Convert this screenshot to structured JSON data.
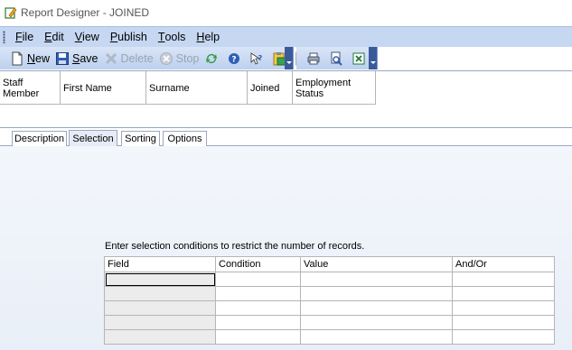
{
  "window": {
    "title": "Report Designer - JOINED"
  },
  "menu": [
    {
      "underline": "F",
      "rest": "ile"
    },
    {
      "underline": "E",
      "rest": "dit"
    },
    {
      "underline": "V",
      "rest": "iew"
    },
    {
      "underline": "P",
      "rest": "ublish"
    },
    {
      "underline": "T",
      "rest": "ools"
    },
    {
      "underline": "H",
      "rest": "elp"
    }
  ],
  "toolbar": {
    "new_u": "N",
    "new_rest": "ew",
    "save_u": "S",
    "save_rest": "ave",
    "delete_label": "Delete",
    "stop_label": "Stop"
  },
  "columns": [
    "Staff Member",
    "First Name",
    "Surname",
    "Joined",
    "Employment Status"
  ],
  "tabs": [
    "Description",
    "Selection",
    "Sorting",
    "Options"
  ],
  "selection": {
    "instruction": "Enter selection conditions to restrict the number of records.",
    "grid_headers": [
      "Field",
      "Condition",
      "Value",
      "And/Or"
    ]
  },
  "colors": {
    "menubar": "#c6d7f2",
    "toolbar": "#bcd0ee",
    "accent": "#3b5a9a"
  }
}
